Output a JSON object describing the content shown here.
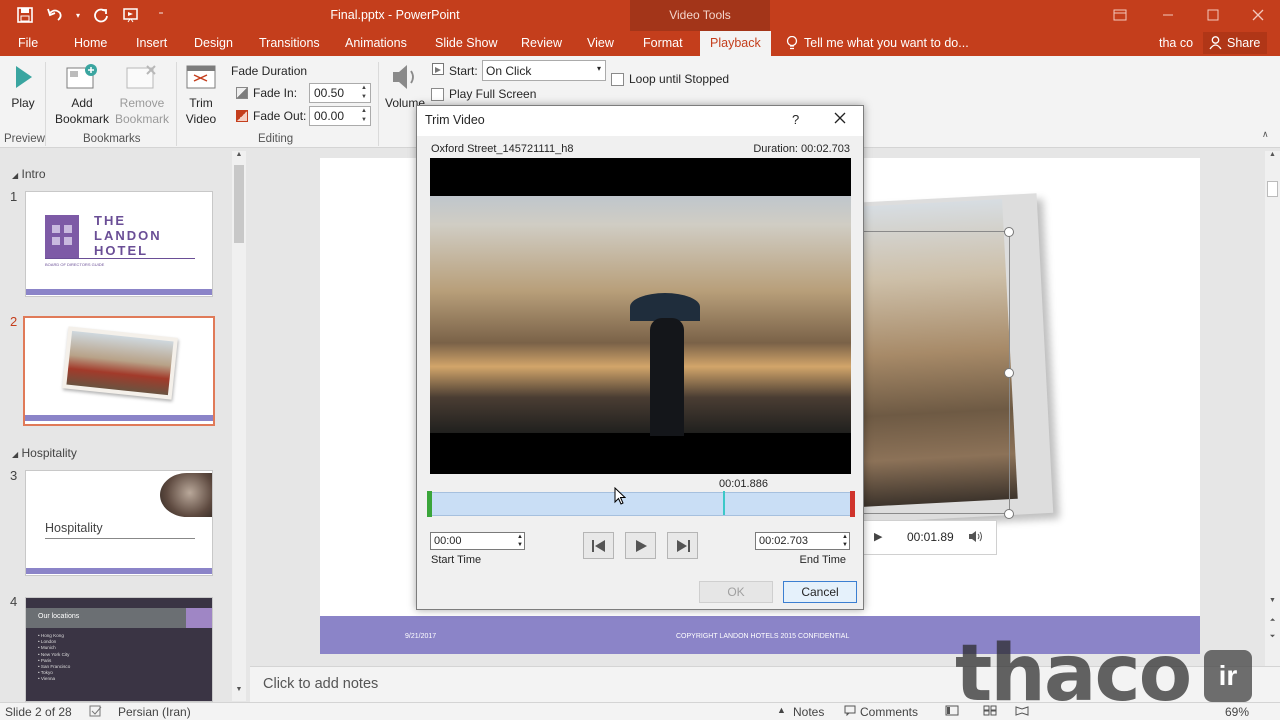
{
  "window": {
    "title": "Final.pptx - PowerPoint",
    "context_title": "Video Tools"
  },
  "tabs": [
    {
      "label": "File"
    },
    {
      "label": "Home"
    },
    {
      "label": "Insert"
    },
    {
      "label": "Design"
    },
    {
      "label": "Transitions"
    },
    {
      "label": "Animations"
    },
    {
      "label": "Slide Show"
    },
    {
      "label": "Review"
    },
    {
      "label": "View"
    },
    {
      "label": "Format"
    },
    {
      "label": "Playback"
    }
  ],
  "tellme": "Tell me what you want to do...",
  "user": "tha co",
  "share": "Share",
  "ribbon": {
    "play": "Play",
    "add_bookmark_l1": "Add",
    "add_bookmark_l2": "Bookmark",
    "remove_bookmark_l1": "Remove",
    "remove_bookmark_l2": "Bookmark",
    "trim_l1": "Trim",
    "trim_l2": "Video",
    "fade_duration": "Fade Duration",
    "fade_in_label": "Fade In:",
    "fade_in_value": "00.50",
    "fade_out_label": "Fade Out:",
    "fade_out_value": "00.00",
    "volume": "Volume",
    "start_label": "Start:",
    "start_value": "On Click",
    "loop": "Loop until Stopped",
    "full_screen": "Play Full Screen",
    "groups": {
      "preview": "Preview",
      "bookmarks": "Bookmarks",
      "editing": "Editing"
    }
  },
  "slides_pane": {
    "sections": [
      "Intro",
      "Hospitality"
    ],
    "slides": [
      {
        "num": "1",
        "title_l1": "THE",
        "title_l2": "LANDON",
        "title_l3": "HOTEL",
        "sub": "BOARD OF DIRECTORS GUIDE"
      },
      {
        "num": "2"
      },
      {
        "num": "3",
        "title": "Hospitality"
      },
      {
        "num": "4",
        "title": "Our locations",
        "items": [
          "Hong Kong",
          "London",
          "Munich",
          "New York City",
          "Paris",
          "San Francisco",
          "Tokyo",
          "Vienna"
        ]
      }
    ]
  },
  "slide": {
    "footer_date": "9/21/2017",
    "footer_text": "COPYRIGHT LANDON HOTELS 2015 CONFIDENTIAL",
    "video_time": "00:01.89"
  },
  "notes_placeholder": "Click to add notes",
  "status": {
    "slide_count": "Slide 2 of 28",
    "language": "Persian (Iran)",
    "notes": "Notes",
    "comments": "Comments",
    "zoom": "69%"
  },
  "dialog": {
    "title": "Trim Video",
    "help": "?",
    "filename": "Oxford Street_145721111_h8",
    "duration": "Duration: 00:02.703",
    "playhead_time": "00:01.886",
    "playhead_fraction": 0.698,
    "start_time": "00:00",
    "start_label": "Start Time",
    "end_time": "00:02.703",
    "end_label": "End Time",
    "ok": "OK",
    "cancel": "Cancel"
  },
  "watermark": {
    "text": "thaco",
    "badge": "ir"
  },
  "colors": {
    "accent": "#c43e1c",
    "footer": "#8b84c8",
    "track": "#c9def5",
    "playhead": "#3cc8c8"
  }
}
